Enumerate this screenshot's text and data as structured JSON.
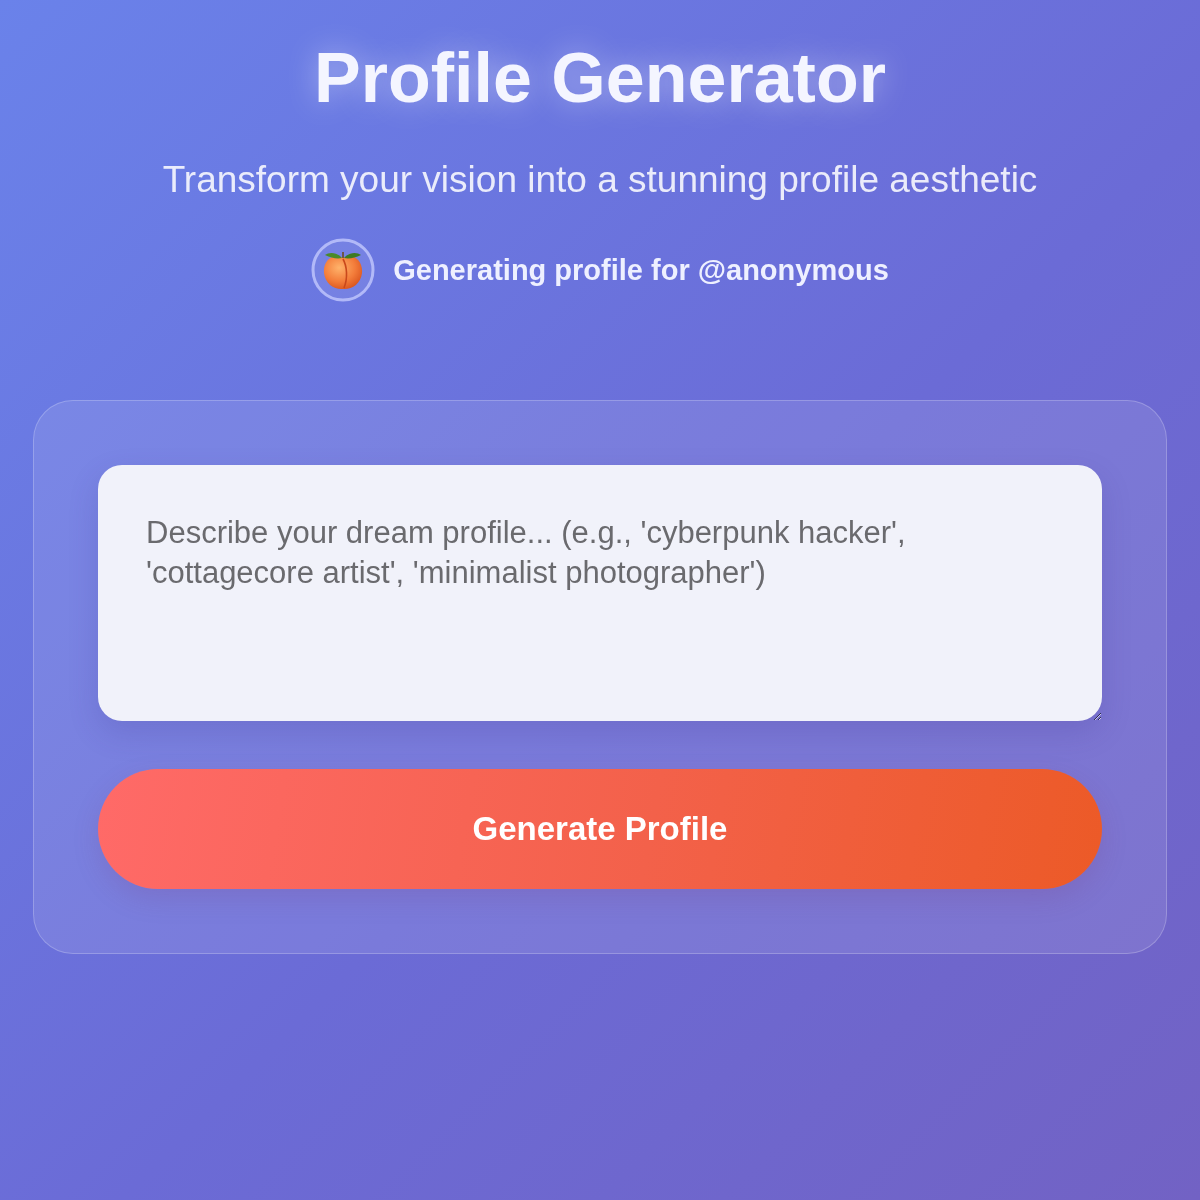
{
  "header": {
    "title": "Profile Generator",
    "subtitle": "Transform your vision into a stunning profile aesthetic"
  },
  "user": {
    "text": "Generating profile for @anonymous"
  },
  "prompt": {
    "placeholder": "Describe your dream profile... (e.g., 'cyberpunk hacker', 'cottagecore artist', 'minimalist photographer')"
  },
  "button": {
    "label": "Generate Profile"
  }
}
